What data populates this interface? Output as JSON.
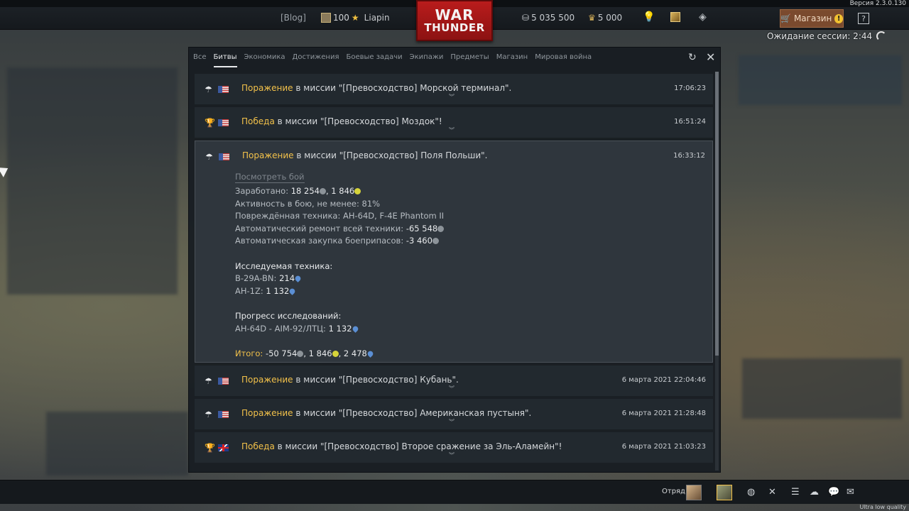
{
  "window": {
    "version": "Версия 2.3.0.130",
    "quality": "Ultra low quality",
    "session": "Ожидание сессии: 2:44"
  },
  "topbar": {
    "blog": "[Blog]",
    "rank": "100",
    "player": "Liapin",
    "silver": "5 035 500",
    "gold": "5 000",
    "shop_label": "Магазин",
    "help": "?"
  },
  "logo": {
    "line1": "WAR",
    "line2": "THUNDER"
  },
  "tabs": [
    {
      "label": "Все"
    },
    {
      "label": "Битвы",
      "active": true
    },
    {
      "label": "Экономика"
    },
    {
      "label": "Достижения"
    },
    {
      "label": "Боевые задачи"
    },
    {
      "label": "Экипажи"
    },
    {
      "label": "Предметы"
    },
    {
      "label": "Магазин"
    },
    {
      "label": "Мировая война"
    }
  ],
  "battles": [
    {
      "result": "Поражение",
      "text": " в миссии \"[Превосходство] Морской терминал\".",
      "time": "17:06:23",
      "flag": "us",
      "icon": "parachute-icon"
    },
    {
      "result": "Победа",
      "text": " в миссии \"[Превосходство] Моздок\"!",
      "time": "16:51:24",
      "flag": "us",
      "icon": "trophy-icon"
    },
    {
      "result": "Поражение",
      "text": " в миссии \"[Превосходство] Поля Польши\".",
      "time": "16:33:12",
      "flag": "us",
      "icon": "parachute-icon",
      "expanded": true
    },
    {
      "result": "Поражение",
      "text": " в миссии \"[Превосходство] Кубань\".",
      "time": "6 марта 2021 22:04:46",
      "flag": "us",
      "icon": "parachute-icon"
    },
    {
      "result": "Поражение",
      "text": " в миссии \"[Превосходство] Американская пустыня\".",
      "time": "6 марта 2021 21:28:48",
      "flag": "us",
      "icon": "parachute-icon"
    },
    {
      "result": "Победа",
      "text": " в миссии \"[Превосходство] Второе сражение за Эль-Аламейн\"!",
      "time": "6 марта 2021 21:03:23",
      "flag": "uk",
      "icon": "trophy-icon"
    }
  ],
  "details": {
    "view_battle": "Посмотреть бой",
    "earned_label": "Заработано: ",
    "earned_silver": "18 254",
    "earned_rp": "1 846",
    "activity": "Активность в бою, не менее: 81%",
    "damaged": "Повреждённая техника: AH-64D, F-4E Phantom II",
    "repair_label": "Автоматический ремонт всей техники: ",
    "repair_value": "-65 548",
    "ammo_label": "Автоматическая закупка боеприпасов: ",
    "ammo_value": "-3 460",
    "research_title": "Исследуемая техника:",
    "research1_label": "B-29A-BN: ",
    "research1_value": "214",
    "research2_label": "AH-1Z: ",
    "research2_value": "1 132",
    "progress_title": "Прогресс исследований:",
    "progress1_label": "AH-64D - AIM-92/ЛТЦ: ",
    "progress1_value": "1 132",
    "total_label": "Итого: ",
    "total_silver": "-50 754",
    "total_rp": "1 846",
    "total_crp": "2 478"
  },
  "bottombar": {
    "squad_label": "Отряд:"
  },
  "colors": {
    "result": "#f2c14a",
    "panel": "#181d22",
    "shop": "#7a4a2e"
  }
}
